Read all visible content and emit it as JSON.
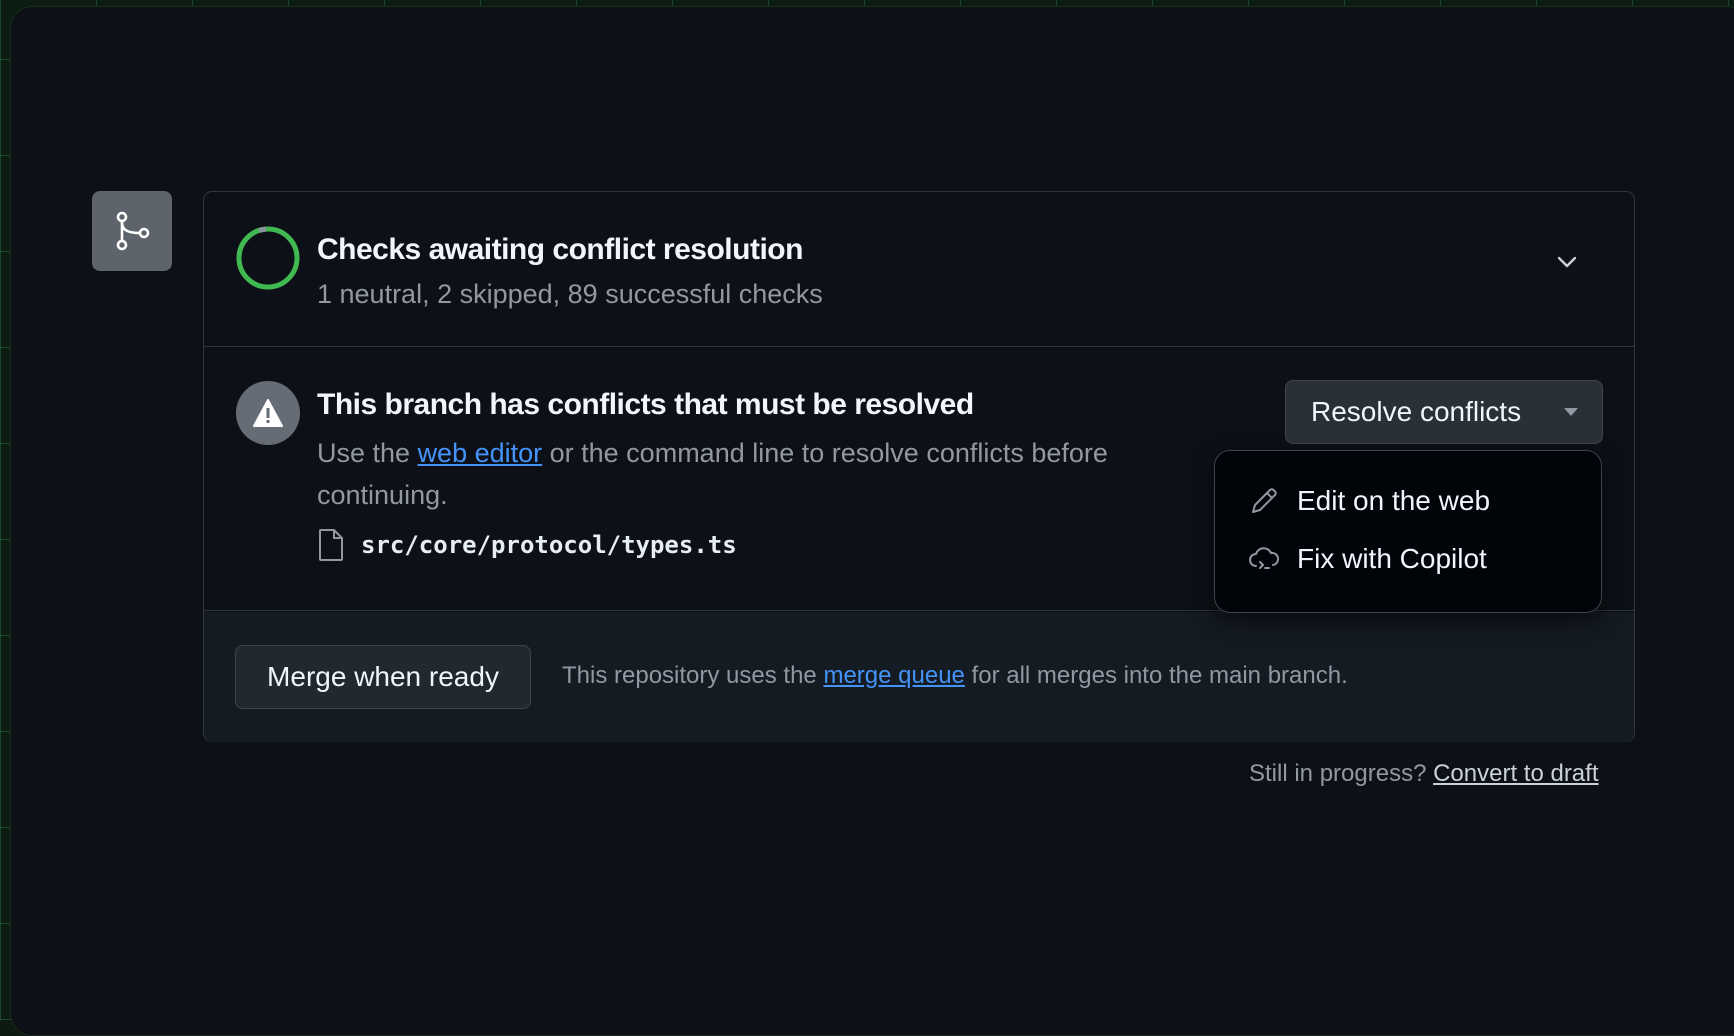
{
  "checks": {
    "title": "Checks awaiting conflict resolution",
    "summary": "1 neutral, 2 skipped, 89 successful checks"
  },
  "conflict": {
    "title": "This branch has conflicts that must be resolved",
    "desc_prefix": "Use the ",
    "desc_link": "web editor",
    "desc_suffix": " or the command line to resolve conflicts before continuing.",
    "file": "src/core/protocol/types.ts",
    "resolve_button": "Resolve conflicts"
  },
  "menu": {
    "items": [
      {
        "label": "Edit on the web",
        "icon": "pencil-icon"
      },
      {
        "label": "Fix with Copilot",
        "icon": "copilot-icon"
      }
    ]
  },
  "merge": {
    "button": "Merge when ready",
    "note_prefix": "This repository uses the ",
    "note_link": "merge queue",
    "note_suffix": " for all merges into the main branch."
  },
  "draft": {
    "prefix": "Still in progress? ",
    "link": "Convert to draft"
  },
  "colors": {
    "accent_link": "#4493f8",
    "success": "#3fb950",
    "background": "#0d1117"
  }
}
